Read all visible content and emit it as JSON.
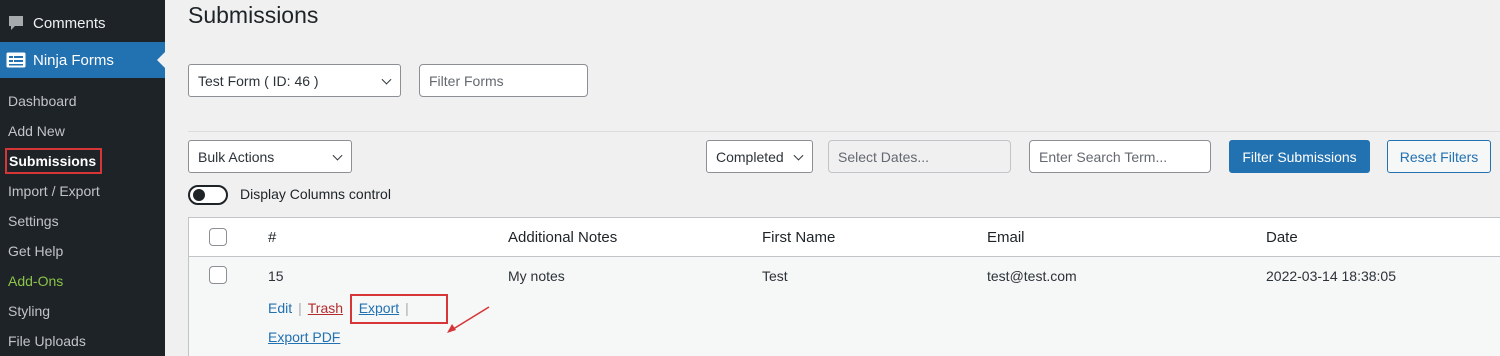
{
  "sidebar": {
    "comments_label": "Comments",
    "ninja_label": "Ninja Forms",
    "items": [
      {
        "label": "Dashboard"
      },
      {
        "label": "Add New"
      },
      {
        "label": "Submissions"
      },
      {
        "label": "Import / Export"
      },
      {
        "label": "Settings"
      },
      {
        "label": "Get Help"
      },
      {
        "label": "Add-Ons"
      },
      {
        "label": "Styling"
      },
      {
        "label": "File Uploads"
      }
    ],
    "current": "Submissions"
  },
  "page": {
    "title": "Submissions"
  },
  "filters": {
    "form_select": "Test Form ( ID: 46 )",
    "filter_forms_placeholder": "Filter Forms",
    "bulk_actions": "Bulk Actions",
    "status_select": "Completed",
    "dates_placeholder": "Select Dates...",
    "search_placeholder": "Enter Search Term...",
    "filter_button": "Filter Submissions",
    "reset_button": "Reset Filters"
  },
  "columns_toggle": {
    "label": "Display Columns control",
    "on": false
  },
  "table": {
    "columns": [
      "#",
      "Additional Notes",
      "First Name",
      "Email",
      "Date"
    ],
    "rows": [
      {
        "id": "15",
        "notes": "My notes",
        "first_name": "Test",
        "email": "test@test.com",
        "date": "2022-03-14 18:38:05",
        "actions": {
          "edit": "Edit",
          "trash": "Trash",
          "export": "Export",
          "export_pdf": "Export PDF",
          "sep": "|"
        }
      }
    ]
  },
  "colors": {
    "accent": "#2271b1",
    "sidebar_bg": "#1d2327",
    "highlight_box": "#d63638"
  }
}
